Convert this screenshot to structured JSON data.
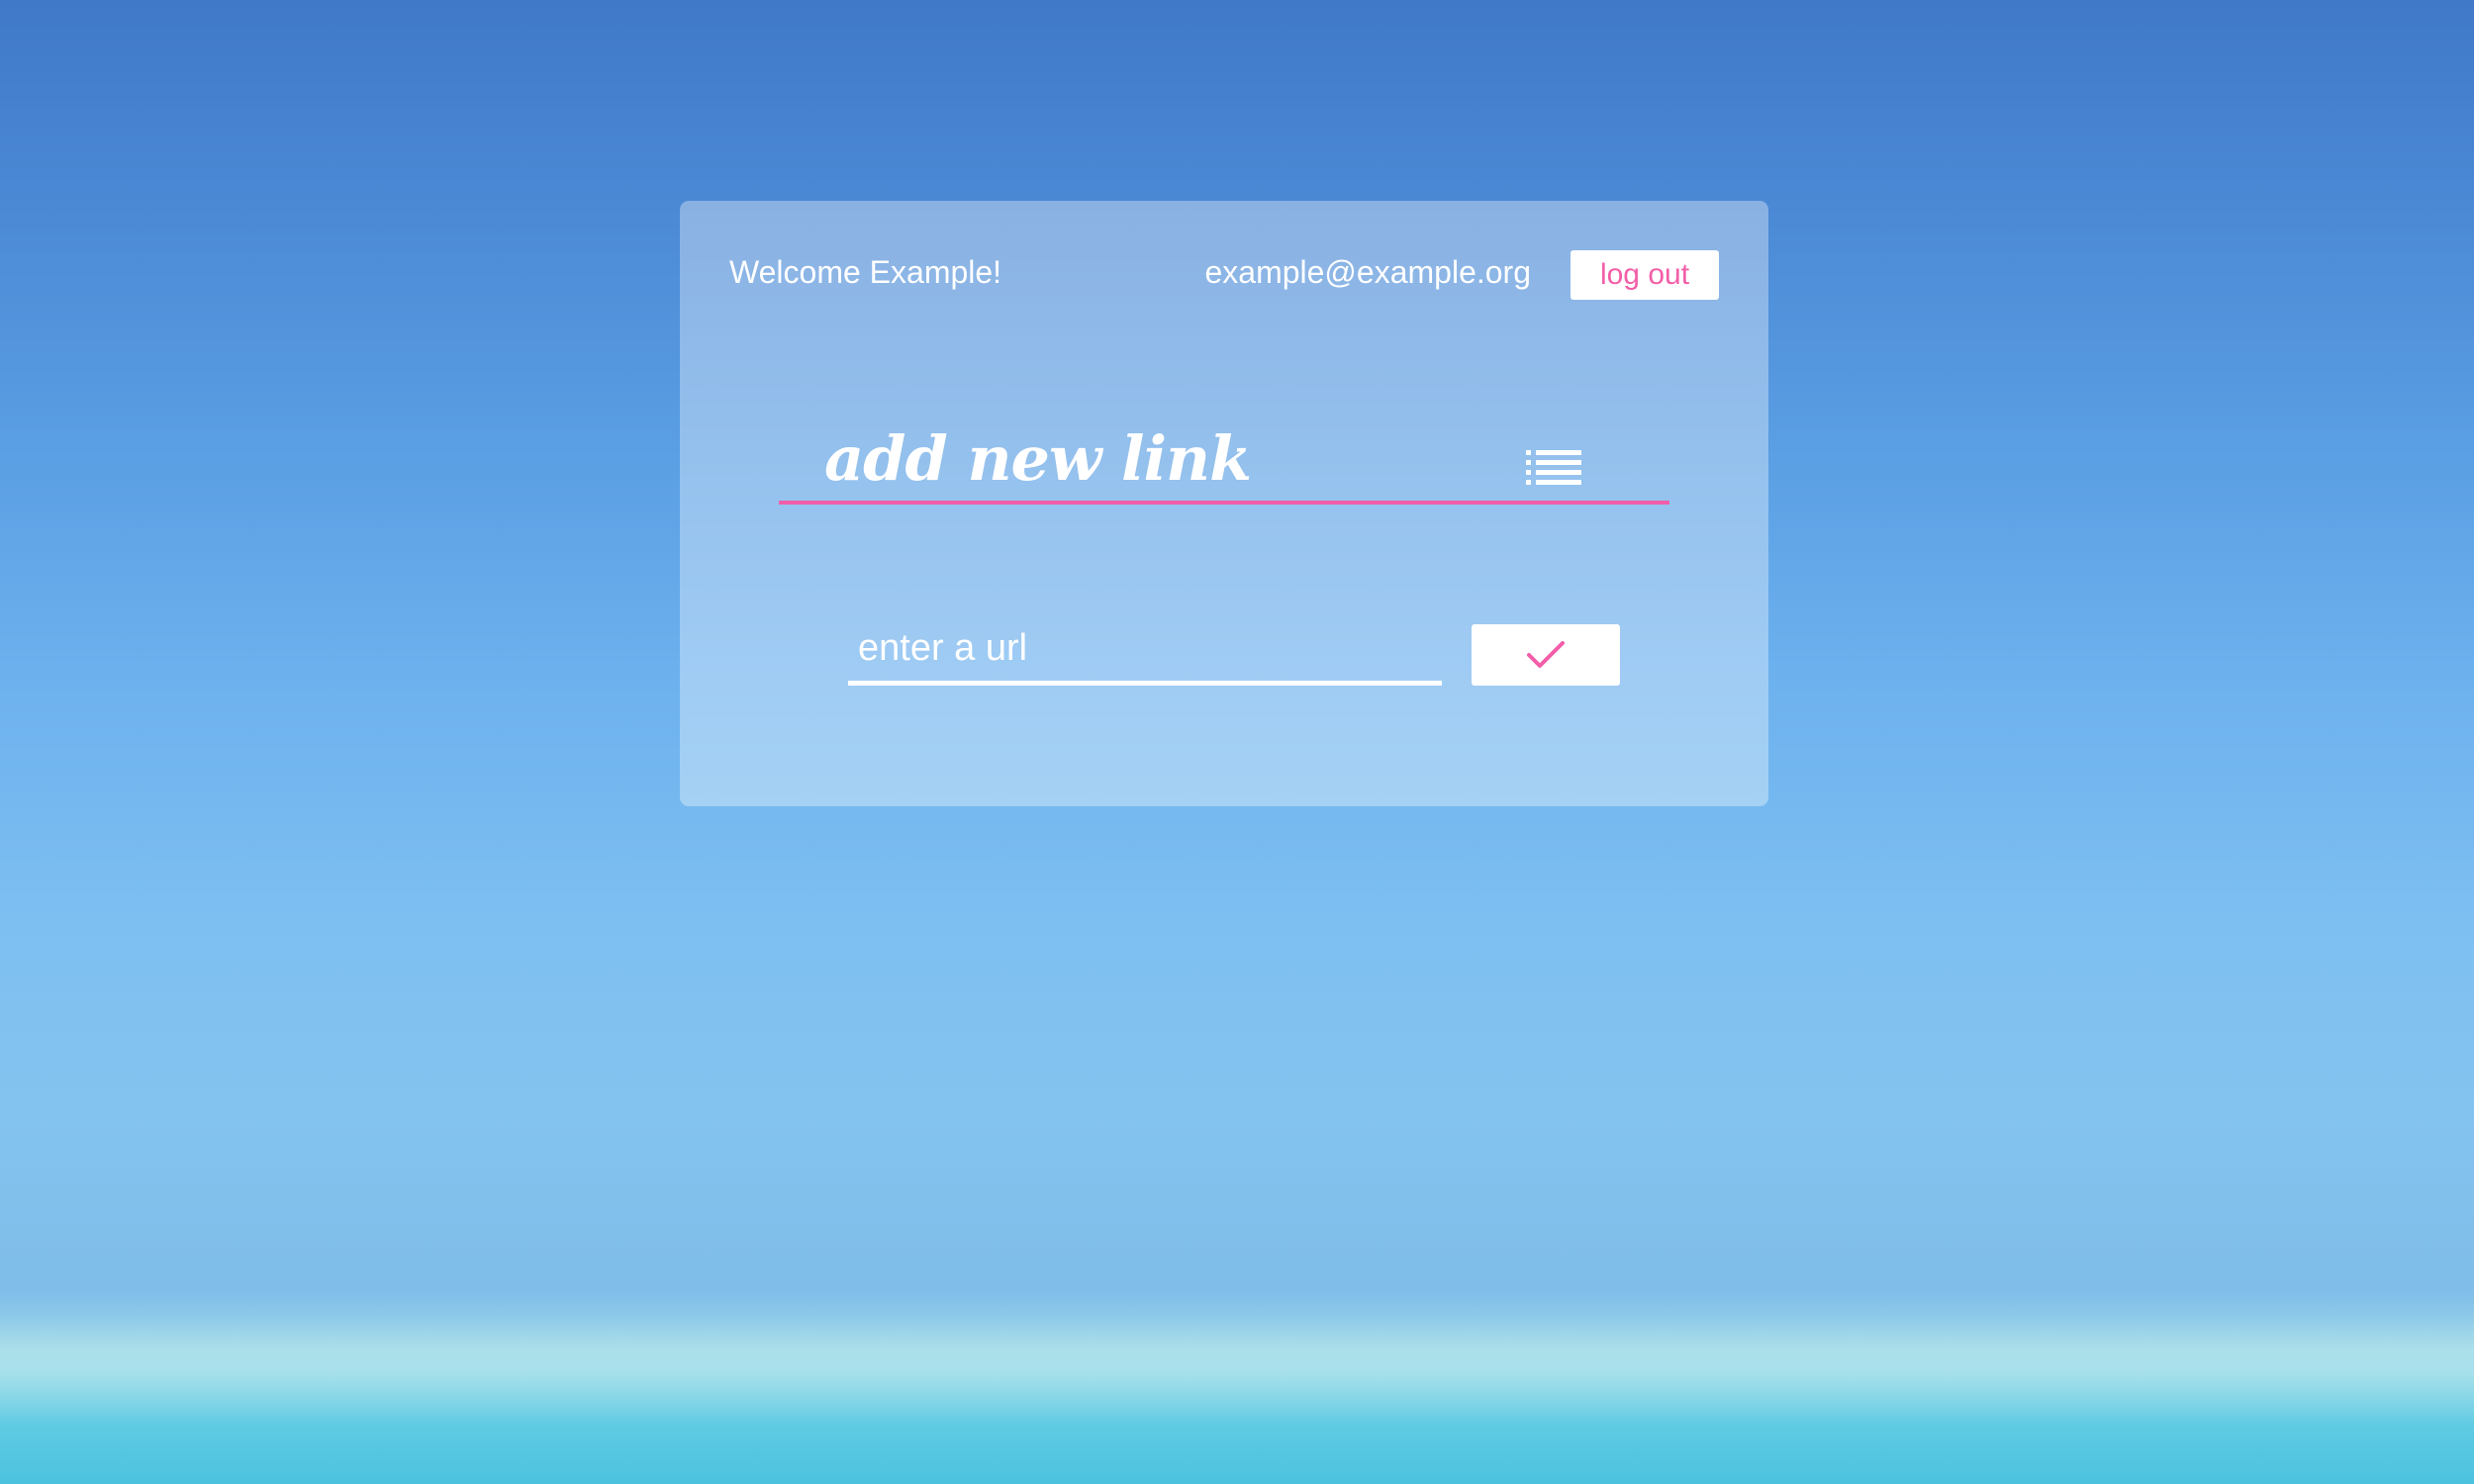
{
  "header": {
    "welcome_text": "Welcome Example!",
    "user_email": "example@example.org",
    "logout_label": "log out"
  },
  "main": {
    "heading": "add new link",
    "list_icon": "list-icon",
    "url_input": {
      "value": "",
      "placeholder": "enter a url"
    },
    "submit_icon": "checkmark-icon"
  },
  "colors": {
    "accent": "#f25ea8",
    "card_background": "rgba(255,255,255,0.35)",
    "text": "#ffffff"
  }
}
